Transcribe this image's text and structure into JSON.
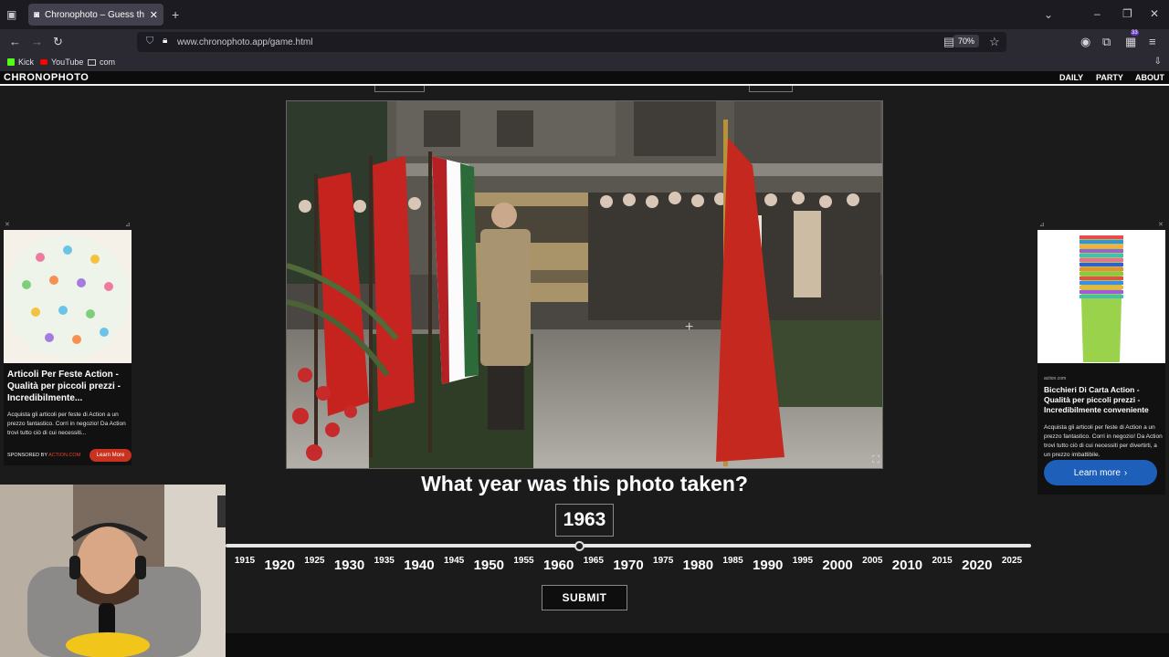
{
  "browser": {
    "tab_title": "Chronophoto – Guess the Year",
    "url": "www.chronophoto.app/game.html",
    "zoom": "70%",
    "extension_badge": "33",
    "bookmarks": [
      {
        "label": "Kick",
        "color": "#53fc18"
      },
      {
        "label": "YouTube",
        "color": "#ff0000"
      },
      {
        "label": "com",
        "color": "#e0e0e6"
      }
    ]
  },
  "site": {
    "logo": "CHRONOPHOTO",
    "nav": [
      "DAILY",
      "PARTY",
      "ABOUT"
    ]
  },
  "game": {
    "question": "What year was this photo taken?",
    "selected_year": "1963",
    "submit_label": "SUBMIT",
    "slider": {
      "min": 1915,
      "max": 2025,
      "value": 1963
    },
    "ticks": [
      "1915",
      "1920",
      "1925",
      "1930",
      "1935",
      "1940",
      "1945",
      "1950",
      "1955",
      "1960",
      "1965",
      "1970",
      "1975",
      "1980",
      "1985",
      "1990",
      "1995",
      "2000",
      "2005",
      "2010",
      "2015",
      "2020",
      "2025"
    ]
  },
  "ads": {
    "left": {
      "title": "Articoli Per Feste Action - Qualità per piccoli prezzi - Incredibilmente...",
      "text": "Acquista gli articoli per feste di Action a un prezzo fantastico. Corri in negozio! Da Action trovi tutto ciò di cui necessiti...",
      "sponsored": "SPONSORED BY",
      "sponsor": "ACTION.COM",
      "cta": "Learn More"
    },
    "right": {
      "source": "action.com",
      "title": "Bicchieri Di Carta Action - Qualità per piccoli prezzi - Incredibilmente conveniente",
      "text": "Acquista gli articoli per feste di Action a un prezzo fantastico. Corri in negozio! Da Action trovi tutto ciò di cui necessiti per divertirti, a un prezzo imbattibile.",
      "cta": "Learn more"
    }
  },
  "colors": {
    "page_bg": "#1b1b1b",
    "ad_cta_red": "#c8321f",
    "ad_cta_blue": "#1d5fb9"
  }
}
